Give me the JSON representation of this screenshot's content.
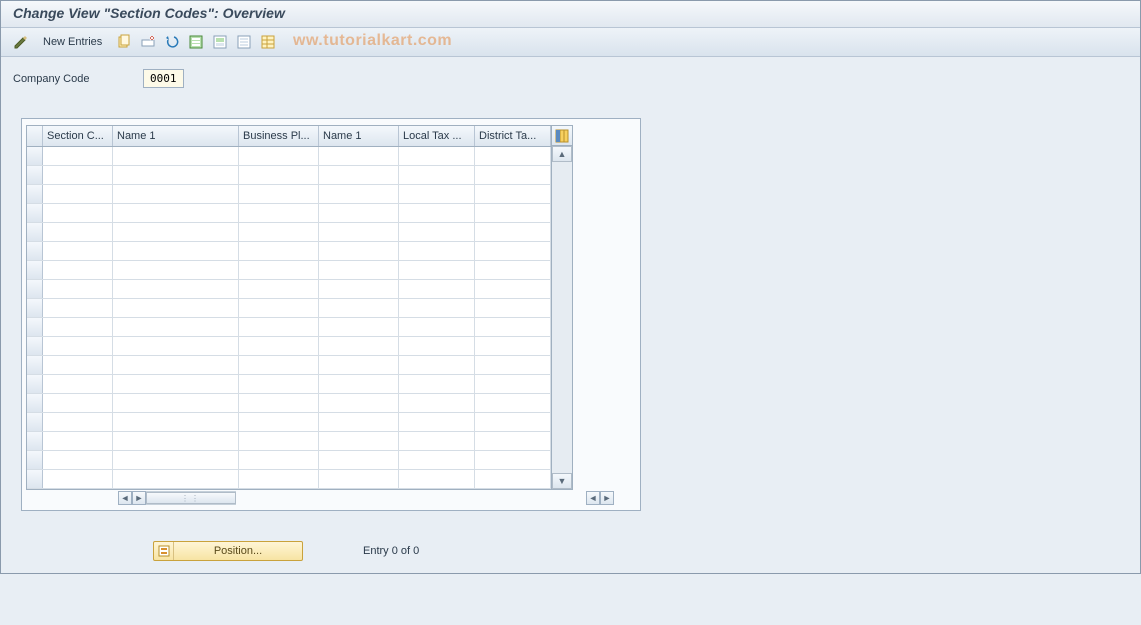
{
  "title": "Change View \"Section Codes\": Overview",
  "toolbar": {
    "new_entries": "New Entries",
    "icons": [
      "edit-icon",
      "copy-icon",
      "delete-icon",
      "undo-icon",
      "select-all-icon",
      "select-block-icon",
      "deselect-all-icon",
      "table-settings-icon"
    ]
  },
  "watermark": "ww.tutorialkart.com",
  "form": {
    "company_code_label": "Company Code",
    "company_code_value": "0001"
  },
  "table": {
    "columns": [
      "Section C...",
      "Name 1",
      "Business Pl...",
      "Name 1",
      "Local Tax ...",
      "District Ta..."
    ],
    "row_count": 18
  },
  "footer": {
    "position_label": "Position...",
    "entry_text": "Entry 0 of 0"
  }
}
